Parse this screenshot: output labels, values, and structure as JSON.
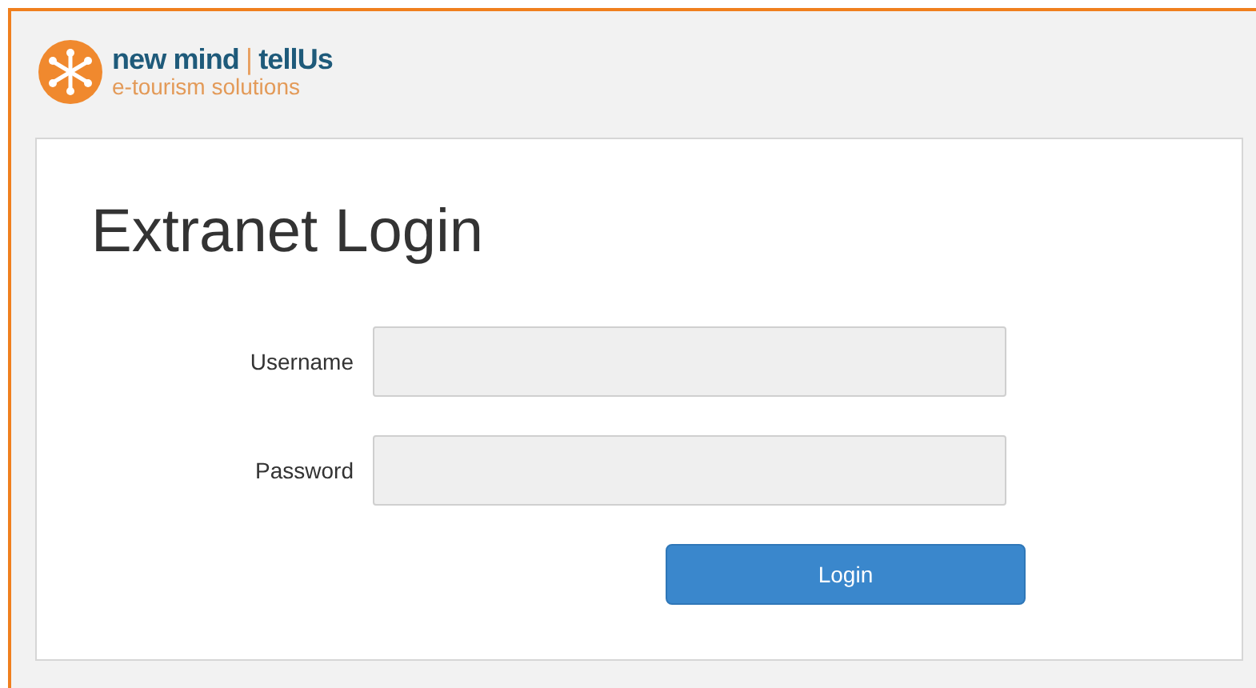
{
  "logo": {
    "brand": "new mind",
    "separator": "|",
    "product": "tellUs",
    "tagline": "e-tourism solutions"
  },
  "login": {
    "title": "Extranet Login",
    "fields": [
      {
        "label": "Username"
      },
      {
        "label": "Password"
      }
    ],
    "button": "Login"
  }
}
